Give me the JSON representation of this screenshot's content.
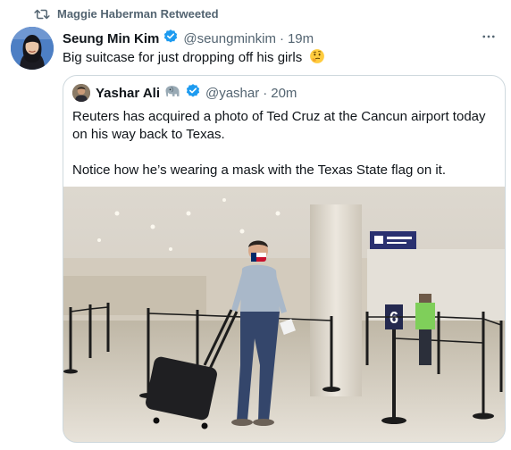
{
  "retweet": {
    "label": "Maggie Haberman Retweeted"
  },
  "tweet": {
    "name": "Seung Min Kim",
    "handle": "@seungminkim",
    "separator": "·",
    "time": "19m",
    "text": "Big suitcase for just dropping off his girls",
    "emoji": "thinking-face"
  },
  "quote": {
    "name": "Yashar Ali",
    "name_emoji": "elephant",
    "handle": "@yashar",
    "separator": "·",
    "time": "20m",
    "paragraph1": "Reuters has acquired a photo of Ted Cruz at the Cancun airport today on his way back to Texas.",
    "paragraph2": "Notice how he’s wearing a mask with the Texas State flag on it.",
    "photo": {
      "sign_number": "6"
    }
  },
  "colors": {
    "verified": "#1d9bf0",
    "secondary_text": "#536471",
    "border": "#cfd9de"
  },
  "icons": [
    "retweet-icon",
    "verified-badge-icon",
    "more-icon",
    "thinking-face-emoji",
    "elephant-emoji"
  ]
}
